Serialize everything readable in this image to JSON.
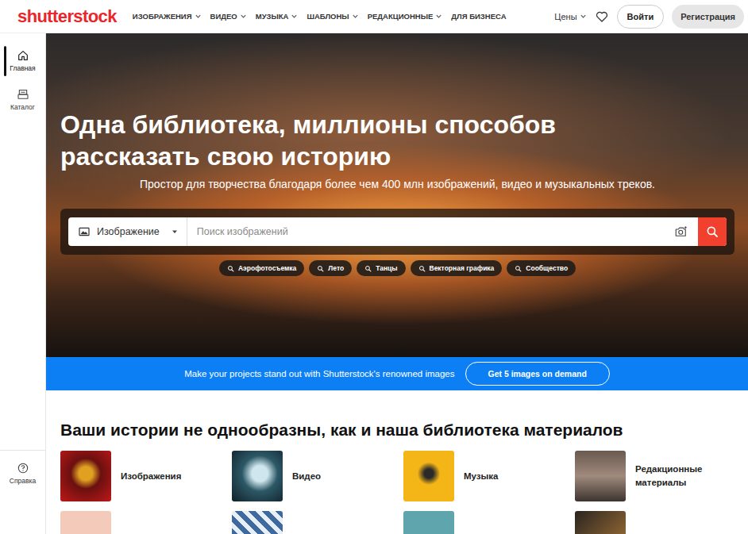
{
  "header": {
    "logo": "shutterstock",
    "nav": [
      {
        "label": "ИЗОБРАЖЕНИЯ",
        "dropdown": true
      },
      {
        "label": "ВИДЕО",
        "dropdown": true
      },
      {
        "label": "МУЗЫКА",
        "dropdown": true
      },
      {
        "label": "ШАБЛОНЫ",
        "dropdown": true
      },
      {
        "label": "РЕДАКЦИОННЫЕ",
        "dropdown": true
      },
      {
        "label": "ДЛЯ БИЗНЕСА",
        "dropdown": false
      }
    ],
    "pricing": {
      "label": "Цены",
      "dropdown": true
    },
    "login": "Войти",
    "register": "Регистрация"
  },
  "sidebar": {
    "items": [
      {
        "label": "Главная",
        "selected": true
      },
      {
        "label": "Каталог",
        "selected": false
      }
    ],
    "help": "Справка"
  },
  "hero": {
    "title": "Одна библиотека, миллионы способов рассказать свою историю",
    "subtitle": "Простор для творчества благодаря более чем 400 млн изображений, видео и музыкальных треков.",
    "search": {
      "type": "Изображение",
      "placeholder": "Поиск изображений"
    },
    "chips": [
      "Аэрофотосъемка",
      "Лето",
      "Танцы",
      "Векторная графика",
      "Сообщество"
    ]
  },
  "banner": {
    "text": "Make your projects stand out with Shutterstock's renowned images",
    "button": "Get 5 images on demand"
  },
  "library": {
    "title": "Ваши истории не однообразны, как и наша библиотека материалов",
    "categories": [
      {
        "label": "Изображения"
      },
      {
        "label": "Видео"
      },
      {
        "label": "Музыка"
      },
      {
        "label": "Редакционные материалы"
      }
    ],
    "next_row": [
      {},
      {},
      {},
      {}
    ]
  }
}
